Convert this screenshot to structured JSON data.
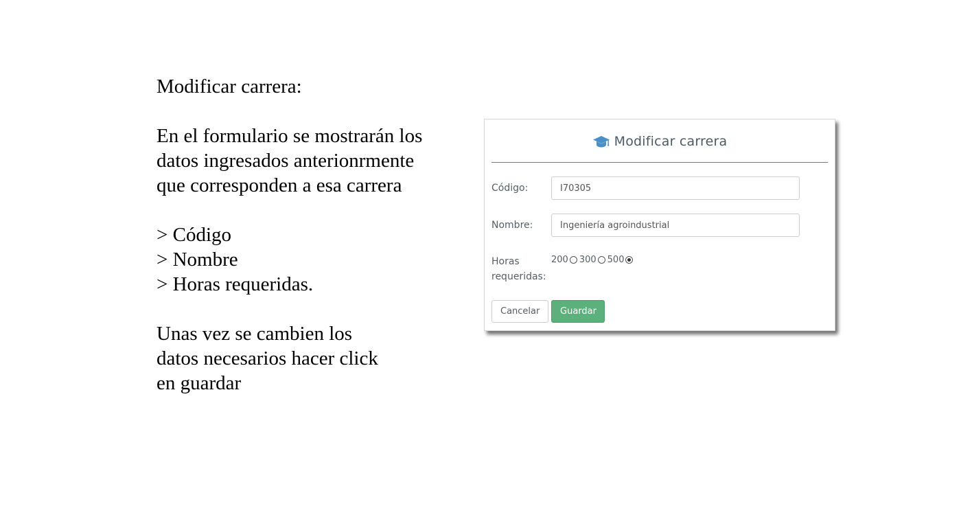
{
  "instructions": {
    "title": "Modificar carrera:",
    "description_lines": [
      "En el formulario se mostrarán los",
      "datos ingresados anterionrmente",
      "que corresponden a esa carrera"
    ],
    "fields_lines": [
      "> Código",
      "> Nombre",
      "> Horas requeridas."
    ],
    "closing_lines": [
      "Unas vez se cambien los",
      "datos necesarios hacer click",
      "en guardar"
    ]
  },
  "modal": {
    "title": "Modificar carrera",
    "title_icon": "graduation-cap-icon",
    "accent_color": "#4a90c8",
    "codigo": {
      "label": "Código:",
      "value": "I70305"
    },
    "nombre": {
      "label": "Nombre:",
      "value": "Ingeniería agroindustrial"
    },
    "horas": {
      "label_line1": "Horas",
      "label_line2": "requeridas:",
      "options": [
        {
          "label": "200",
          "checked": false
        },
        {
          "label": "300",
          "checked": false
        },
        {
          "label": "500",
          "checked": true
        }
      ]
    },
    "buttons": {
      "cancel_label": "Cancelar",
      "save_label": "Guardar",
      "save_color": "#5cb07c"
    }
  }
}
